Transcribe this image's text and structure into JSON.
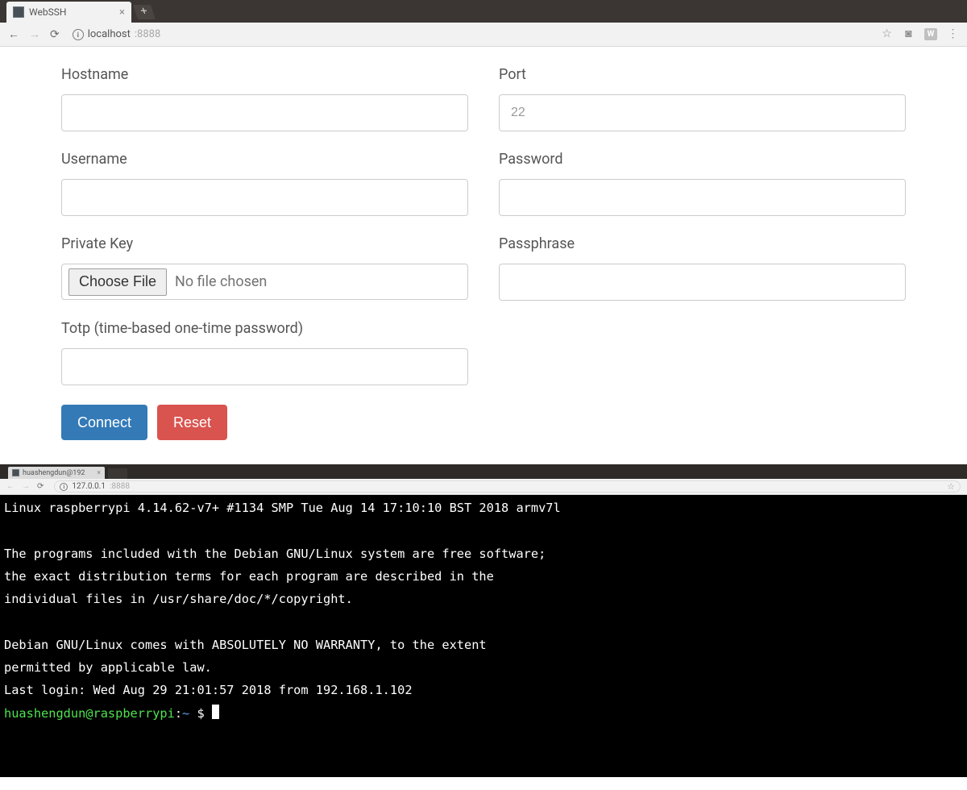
{
  "window1": {
    "tab_title": "WebSSH",
    "url_host": "localhost",
    "url_port": ":8888"
  },
  "form": {
    "hostname": {
      "label": "Hostname",
      "value": ""
    },
    "port": {
      "label": "Port",
      "placeholder": "22",
      "value": ""
    },
    "username": {
      "label": "Username",
      "value": ""
    },
    "password": {
      "label": "Password",
      "value": ""
    },
    "privatekey": {
      "label": "Private Key",
      "button": "Choose File",
      "status": "No file chosen"
    },
    "passphrase": {
      "label": "Passphrase",
      "value": ""
    },
    "totp": {
      "label": "Totp (time-based one-time password)",
      "value": ""
    },
    "connect_btn": "Connect",
    "reset_btn": "Reset"
  },
  "window2": {
    "tab_title": "huashengdun@192",
    "url_host": "127.0.0.1",
    "url_port": ":8888"
  },
  "terminal": {
    "line1": "Linux raspberrypi 4.14.62-v7+ #1134 SMP Tue Aug 14 17:10:10 BST 2018 armv7l",
    "line2": "",
    "line3": "The programs included with the Debian GNU/Linux system are free software;",
    "line4": "the exact distribution terms for each program are described in the",
    "line5": "individual files in /usr/share/doc/*/copyright.",
    "line6": "",
    "line7": "Debian GNU/Linux comes with ABSOLUTELY NO WARRANTY, to the extent",
    "line8": "permitted by applicable law.",
    "line9": "Last login: Wed Aug 29 21:01:57 2018 from 192.168.1.102",
    "prompt_user": "huashengdun@raspberrypi",
    "prompt_sep": ":",
    "prompt_path": "~",
    "prompt_dollar": " $ "
  }
}
